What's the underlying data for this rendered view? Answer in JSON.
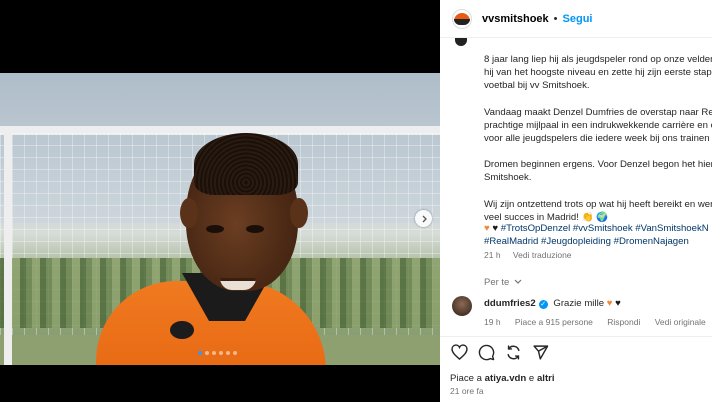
{
  "post": {
    "account": "vvsmitshoek",
    "separator": "•",
    "follow_label": "Segui",
    "caption": [
      "8 jaar lang liep hij als jeugdspeler rond op onze velden,",
      "hij van het hoogste niveau en zette hij zijn eerste stapp",
      "voetbal bij vv Smitshoek."
    ],
    "caption2": [
      "Vandaag maakt Denzel Dumfries de overstap naar Real",
      "prachtige mijlpaal in een indrukwekkende carrière en e",
      "voor alle jeugdspelers die iedere week bij ons trainen e"
    ],
    "caption3": [
      "Dromen beginnen ergens. Voor Denzel begon het hier,",
      "Smitshoek."
    ],
    "caption4": [
      "Wij zijn ontzettend trots op wat hij heeft bereikt en wer",
      "veel succes in Madrid! 👏 🌍"
    ],
    "hashtags_line1": "#TrotsOpDenzel #vvSmitshoek #VanSmitshoekN",
    "hashtags_line2": "#RealMadrid #Jeugdopleiding #DromenNajagen",
    "time_ago": "21 h",
    "see_translation": "Vedi traduzione",
    "for_you": "Per te",
    "comment": {
      "user": "ddumfries2",
      "verified_mark": "✓",
      "text": "Grazie mille",
      "time": "19 h",
      "likes": "Piace a 915 persone",
      "reply": "Rispondi",
      "original": "Vedi originale"
    },
    "liked_by_prefix": "Piace a ",
    "liked_by_user": "atiya.vdn",
    "liked_by_middle": " e ",
    "liked_by_others": "altri",
    "posted": "21 ore fa"
  },
  "icons": {
    "next": "chevron-right-icon",
    "like": "heart-icon",
    "comment": "comment-icon",
    "share": "repost-icon",
    "send": "send-icon"
  },
  "carousel": {
    "total": 6,
    "active_index": 0
  },
  "colors": {
    "accent": "#0095f6",
    "club_orange": "#e86a14",
    "link": "#00376b"
  }
}
